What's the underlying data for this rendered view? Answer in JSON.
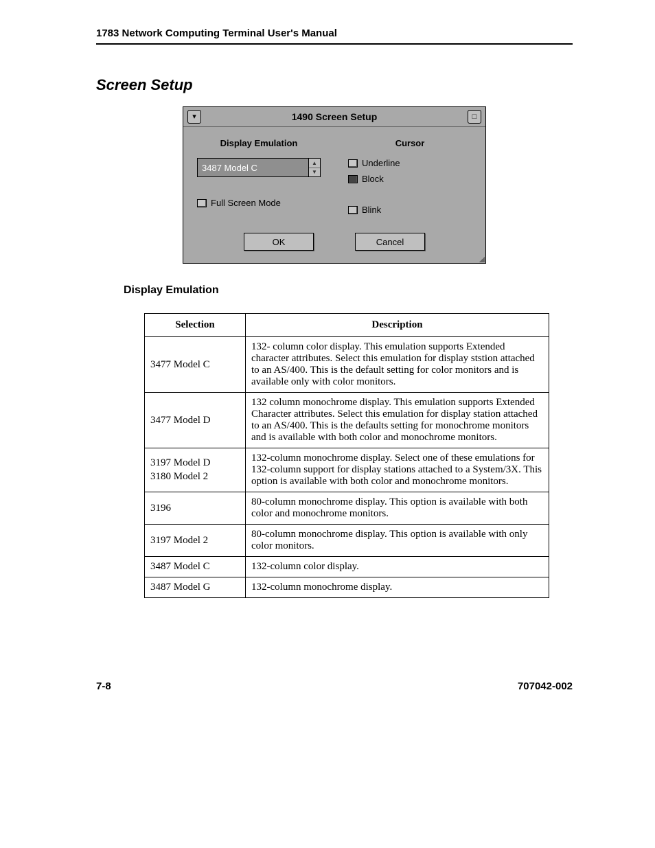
{
  "header": {
    "running": "1783 Network Computing Terminal User's Manual"
  },
  "section_title": "Screen Setup",
  "dialog": {
    "title": "1490 Screen Setup",
    "groups": {
      "emulation_label": "Display Emulation",
      "emulation_value": "3487 Model C",
      "full_screen_label": "Full Screen Mode",
      "cursor_label": "Cursor",
      "underline_label": "Underline",
      "block_label": "Block",
      "blink_label": "Blink"
    },
    "buttons": {
      "ok": "OK",
      "cancel": "Cancel"
    }
  },
  "subheading": "Display Emulation",
  "table": {
    "head": {
      "selection": "Selection",
      "description": "Description"
    },
    "rows": [
      {
        "selection": "3477 Model C",
        "description": "132- column color display.  This emulation supports Extended character attributes.  Select this emulation for display ststion attached to an AS/400.  This is the default setting for color monitors and is available only with color monitors."
      },
      {
        "selection": "3477 Model D",
        "description": "132 column monochrome display.  This emulation supports Extended Character attributes.  Select this emulation for display station attached to an AS/400. This is the defaults setting for monochrome monitors and is available with both color and monochrome monitors."
      },
      {
        "selection_lines": [
          "3197 Model D",
          "3180 Model 2"
        ],
        "description": "132-column monochrome display.  Select one of these emulations for 132-column support for display stations attached to a System/3X.  This option is available with both color  and monochrome monitors."
      },
      {
        "selection": "3196",
        "description": "80-column monochrome display. This option is available with both color and monochrome monitors."
      },
      {
        "selection": "3197 Model 2",
        "description": "80-column monochrome display. This option is available with only color monitors."
      },
      {
        "selection": "3487 Model C",
        "description": "132-column color display."
      },
      {
        "selection": "3487 Model G",
        "description": "132-column monochrome display."
      }
    ]
  },
  "footer": {
    "page": "7-8",
    "docnum": "707042-002"
  }
}
